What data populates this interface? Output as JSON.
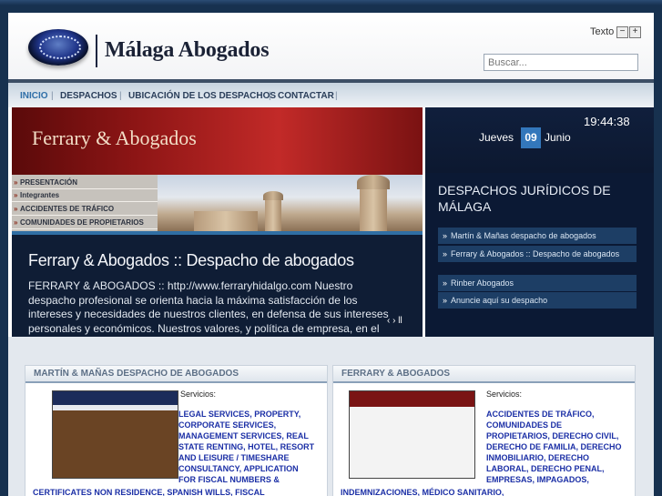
{
  "header": {
    "site_title": "Málaga Abogados",
    "text_size_label": "Texto",
    "text_minus": "−",
    "text_plus": "+",
    "search_placeholder": "Buscar..."
  },
  "nav": {
    "items": [
      {
        "label": "INICIO",
        "active": true
      },
      {
        "label": "DESPACHOS"
      },
      {
        "label": "UBICACIÓN DE LOS DESPACHOS"
      },
      {
        "label": "CONTACTAR"
      }
    ],
    "separator": "|"
  },
  "feature": {
    "banner_title": "Ferrary & Abogados",
    "side_menu": [
      "PRESENTACIÓN",
      "Integrantes",
      "ACCIDENTES DE TRÁFICO",
      "COMUNIDADES DE PROPIETARIOS"
    ],
    "title": "Ferrary & Abogados :: Despacho de abogados",
    "text": "FERRARY & ABOGADOS :: http://www.ferraryhidalgo.com Nuestro despacho profesional se orienta hacia la máxima satisfacción de los intereses y necesidades de nuestros clientes, en defensa de sus intereses personales y económicos. Nuestros valores, y política de empresa, en el ejercicio de la",
    "controls": "‹ › ll"
  },
  "date": {
    "time": "19:44:38",
    "day_name": "Jueves",
    "day_number": "09",
    "month": "Junio"
  },
  "despachos": {
    "title": "DESPACHOS JURÍDICOS DE MÁLAGA",
    "items": [
      "Martín & Mañas despacho de abogados",
      "Ferrary & Abogados :: Despacho de abogados",
      "Rinber Abogados",
      "Anuncie aquí su despacho"
    ]
  },
  "cards": [
    {
      "title": "MARTÍN & MAÑAS DESPACHO DE ABOGADOS",
      "services_label": "Servicios:",
      "services": "LEGAL SERVICES, PROPERTY, CORPORATE SERVICES, MANAGEMENT SERVICES, REAL STATE RENTING, HOTEL, RESORT AND LEISURE / TIMESHARE CONSULTANCY, APPLICATION FOR FISCAL NUMBERS &",
      "services_tail": "CERTIFICATES NON RESIDENCE, SPANISH WILLS, FISCAL"
    },
    {
      "title": "FERRARY & ABOGADOS",
      "services_label": "Servicios:",
      "services": "ACCIDENTES DE TRÁFICO, COMUNIDADES DE PROPIETARIOS, DERECHO CIVIL, DERECHO DE FAMILIA, DERECHO INMOBILIARIO, DERECHO LABORAL, DERECHO PENAL, EMPRESAS, IMPAGADOS,",
      "services_tail": "INDEMNIZACIONES, MÉDICO SANITARIO,"
    }
  ],
  "colors": {
    "page_bg": "#17314f",
    "nav_active": "#2f6fa8",
    "accent_blue": "#3377bb",
    "services_text": "#1b2fa6",
    "banner_red": "#c22a28"
  }
}
